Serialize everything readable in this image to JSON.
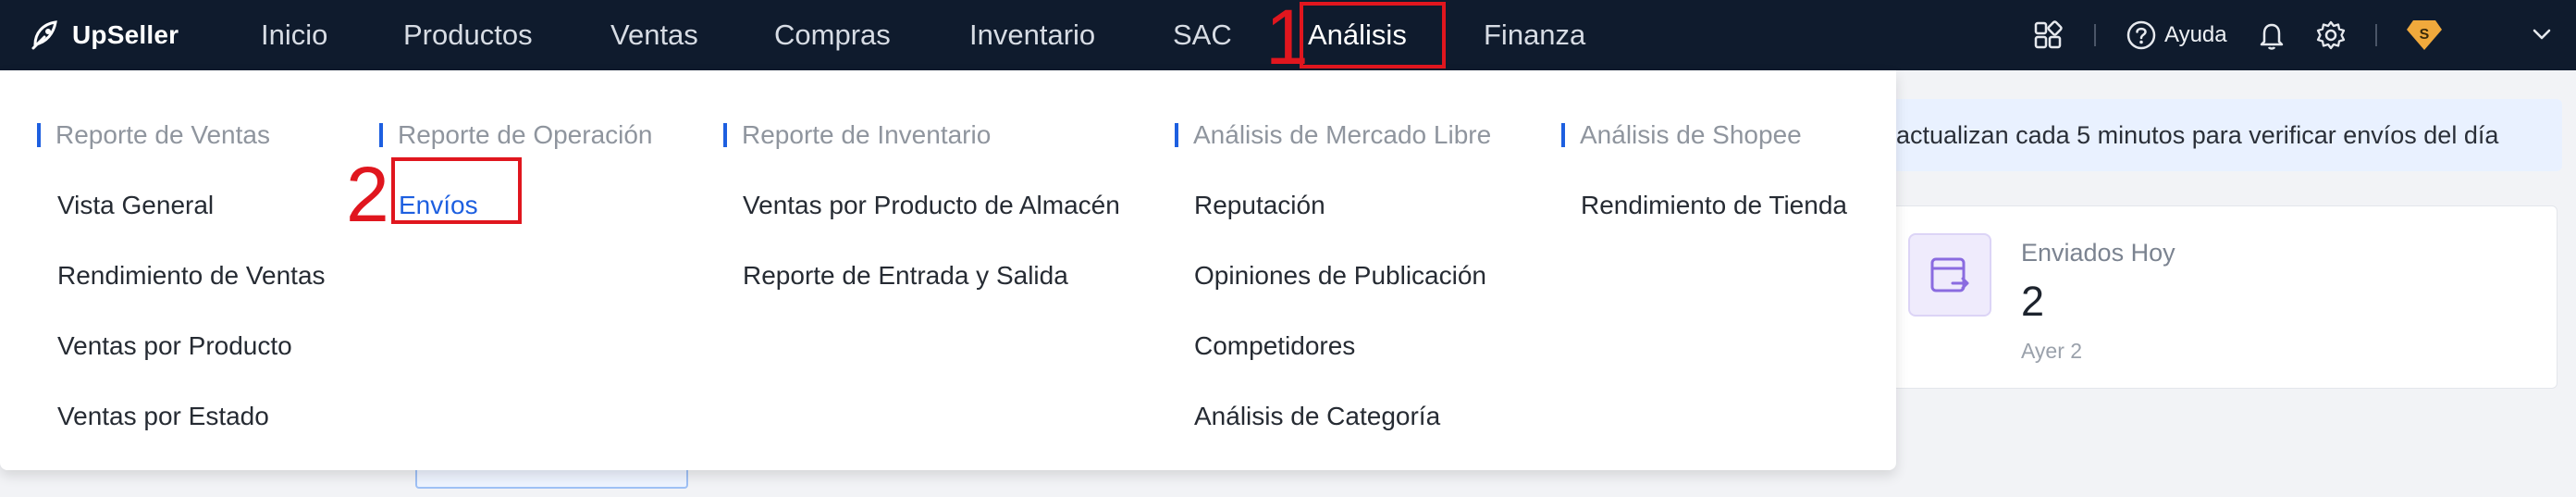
{
  "brand": {
    "name": "UpSeller"
  },
  "nav": {
    "items": [
      "Inicio",
      "Productos",
      "Ventas",
      "Compras",
      "Inventario",
      "SAC",
      "Análisis",
      "Finanza"
    ],
    "active": "Análisis",
    "help_label": "Ayuda",
    "avatar_letter": "S"
  },
  "annotations": {
    "step1": "1",
    "step2": "2"
  },
  "background": {
    "notice_text": "actualizan cada 5 minutos para verificar envíos del día",
    "card": {
      "title": "Enviados Hoy",
      "value": "2",
      "sub": "Ayer 2"
    }
  },
  "menu": {
    "columns": [
      {
        "heading": "Reporte de Ventas",
        "links": [
          "Vista General",
          "Rendimiento de Ventas",
          "Ventas por Producto",
          "Ventas por Estado"
        ]
      },
      {
        "heading": "Reporte de Operación",
        "links": [
          "Envíos"
        ]
      },
      {
        "heading": "Reporte de Inventario",
        "links": [
          "Ventas por Producto de Almacén",
          "Reporte de Entrada y Salida"
        ]
      },
      {
        "heading": "Análisis de Mercado Libre",
        "links": [
          "Reputación",
          "Opiniones de Publicación",
          "Competidores",
          "Análisis de Categoría"
        ]
      },
      {
        "heading": "Análisis de Shopee",
        "links": [
          "Rendimiento de Tienda"
        ]
      }
    ],
    "selected_link": "Envíos"
  },
  "colors": {
    "navbar": "#0f1b2d",
    "accent": "#1d5fe0",
    "annotation": "#e0161e"
  }
}
